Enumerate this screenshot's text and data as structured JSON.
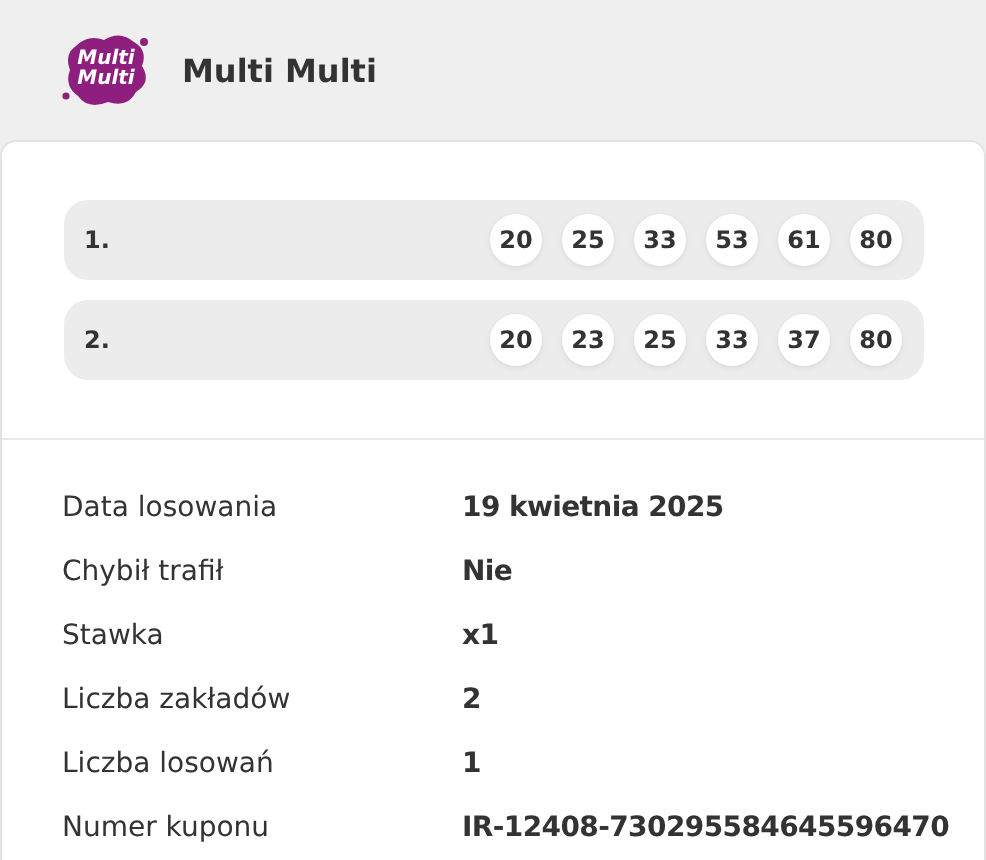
{
  "header": {
    "logo_text": [
      "Multi",
      "Multi"
    ],
    "title": "Multi Multi"
  },
  "bets": [
    {
      "label": "1.",
      "numbers": [
        "20",
        "25",
        "33",
        "53",
        "61",
        "80"
      ]
    },
    {
      "label": "2.",
      "numbers": [
        "20",
        "23",
        "25",
        "33",
        "37",
        "80"
      ]
    }
  ],
  "details": [
    {
      "label": "Data losowania",
      "value": "19 kwietnia 2025"
    },
    {
      "label": "Chybił trafił",
      "value": "Nie"
    },
    {
      "label": "Stawka",
      "value": "x1"
    },
    {
      "label": "Liczba zakładów",
      "value": "2"
    },
    {
      "label": "Liczba losowań",
      "value": "1"
    },
    {
      "label": "Numer kuponu",
      "value": "IR-12408-730295584645596470"
    }
  ]
}
